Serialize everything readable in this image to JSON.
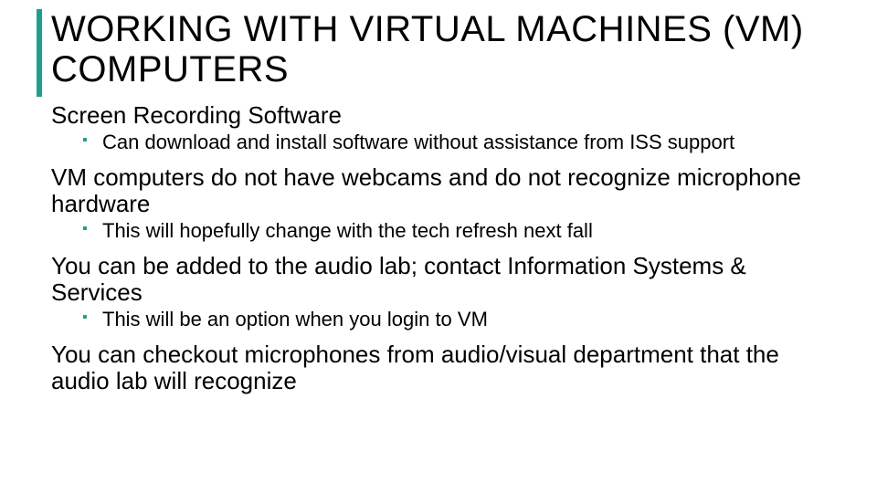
{
  "title": "WORKING WITH VIRTUAL MACHINES (VM) COMPUTERS",
  "sections": [
    {
      "lead": "Screen Recording Software",
      "bullets": [
        "Can download and install software without assistance from ISS support"
      ]
    },
    {
      "lead": "VM computers do not have webcams and do not recognize microphone hardware",
      "bullets": [
        "This will hopefully change with the tech refresh next fall"
      ]
    },
    {
      "lead": "You can be added to the audio lab; contact Information Systems & Services",
      "bullets": [
        "This will be an option when you login to VM"
      ]
    },
    {
      "lead": "You can checkout microphones from audio/visual department that the  audio lab will recognize",
      "bullets": []
    }
  ]
}
